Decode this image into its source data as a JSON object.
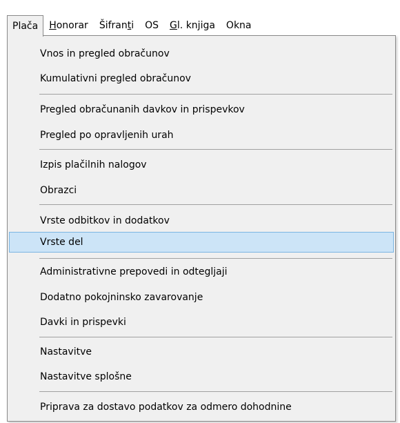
{
  "menubar": {
    "items": [
      {
        "label": "Plača",
        "open": true
      },
      {
        "label_prefix": "",
        "label_underlined": "H",
        "label_rest": "onorar"
      },
      {
        "label_prefix": "Šifran",
        "label_underlined": "t",
        "label_rest": "i"
      },
      {
        "label": "OS"
      },
      {
        "label_prefix": "",
        "label_underlined": "G",
        "label_rest": "l. knjiga"
      },
      {
        "label": "Okna"
      }
    ]
  },
  "dropdown": {
    "items": [
      "Vnos in pregled obračunov",
      "Kumulativni pregled obračunov",
      "Pregled obračunanih davkov in prispevkov",
      "Pregled po opravljenih urah",
      "Izpis plačilnih nalogov",
      "Obrazci",
      "Vrste odbitkov in dodatkov",
      "Vrste del",
      "Administrativne prepovedi in odtegljaji",
      "Dodatno pokojninsko zavarovanje",
      "Davki in prispevki",
      "Nastavitve",
      "Nastavitve splošne",
      "Priprava za dostavo podatkov za odmero dohodnine"
    ],
    "highlighted_index": 7,
    "highlight_color": "#cce4f7",
    "highlight_border": "#7ab4e2"
  }
}
